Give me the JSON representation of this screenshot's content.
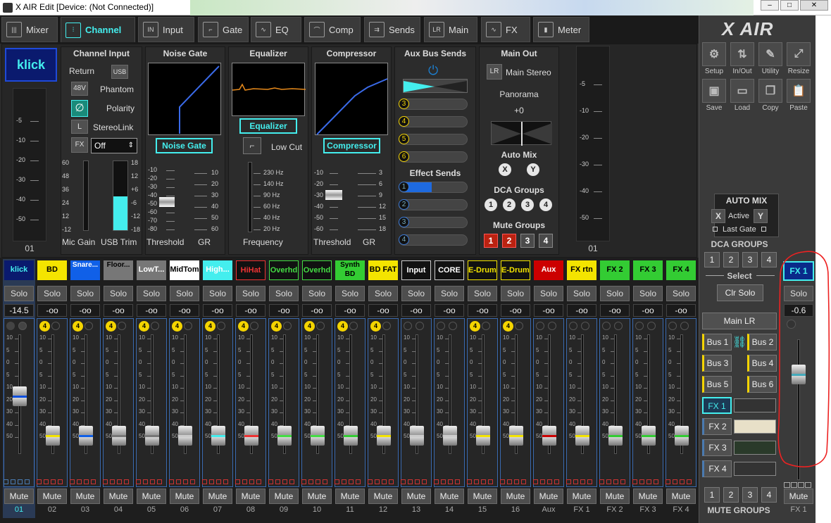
{
  "window": {
    "title": "X AIR Edit [Device: (Not Connected)]"
  },
  "tabs": [
    {
      "label": "Mixer",
      "icon": "mixer-icon",
      "glyph": "|||"
    },
    {
      "label": "Channel",
      "icon": "channel-icon",
      "glyph": "⫶"
    },
    {
      "label": "Input",
      "icon": "input-icon",
      "glyph": "IN"
    },
    {
      "label": "Gate",
      "icon": "gate-icon",
      "glyph": "⌐"
    },
    {
      "label": "EQ",
      "icon": "eq-icon",
      "glyph": "∿"
    },
    {
      "label": "Comp",
      "icon": "comp-icon",
      "glyph": "⌒"
    },
    {
      "label": "Sends",
      "icon": "sends-icon",
      "glyph": "⇉"
    },
    {
      "label": "Main",
      "icon": "main-icon",
      "glyph": "LR"
    },
    {
      "label": "FX",
      "icon": "fx-icon",
      "glyph": "∿"
    },
    {
      "label": "Meter",
      "icon": "meter-icon",
      "glyph": "▮"
    }
  ],
  "channel": {
    "name": "klick",
    "left_scale": [
      "-5",
      "-10",
      "-20",
      "-30",
      "-40",
      "-50"
    ],
    "number": "01",
    "input": {
      "title": "Channel Input",
      "return_label": "Return",
      "usb_btn": "USB",
      "phantom_btn": "48V",
      "phantom_label": "Phantom",
      "polarity_label": "Polarity",
      "polarity_glyph": "∅",
      "stereolink_btn": "L",
      "stereolink_label": "StereoLink",
      "fx_btn": "FX",
      "fx_select": "Off",
      "mic_scale": [
        "60",
        "48",
        "36",
        "24",
        "12",
        "-12"
      ],
      "trim_scale": [
        "18",
        "12",
        "+6",
        "-6",
        "-12",
        "-18"
      ],
      "mic_label": "Mic Gain",
      "trim_label": "USB Trim"
    },
    "gate": {
      "title": "Noise Gate",
      "button": "Noise Gate",
      "scale": [
        "-10",
        "-20",
        "-30",
        "-40",
        "-50",
        "-60",
        "-70",
        "-80"
      ],
      "gr_scale": [
        "10",
        "20",
        "30",
        "40",
        "50",
        "60"
      ],
      "threshold_label": "Threshold",
      "gr_label": "GR"
    },
    "eq": {
      "title": "Equalizer",
      "button": "Equalizer",
      "lowcut_label": "Low Cut",
      "freq_scale": [
        "230 Hz",
        "140 Hz",
        "90 Hz",
        "60 Hz",
        "40 Hz",
        "20 Hz"
      ],
      "freq_label": "Frequency"
    },
    "comp": {
      "title": "Compressor",
      "button": "Compressor",
      "scale": [
        "-10",
        "-20",
        "-30",
        "-40",
        "-50",
        "-60"
      ],
      "gr_scale": [
        "3",
        "6",
        "9",
        "12",
        "15",
        "18"
      ],
      "threshold_label": "Threshold",
      "gr_label": "GR"
    },
    "aux": {
      "title": "Aux Bus Sends",
      "buses": [
        "3",
        "4",
        "5",
        "6"
      ],
      "fx_title": "Effect Sends",
      "fx": [
        "1",
        "2",
        "3",
        "4"
      ]
    },
    "main": {
      "title": "Main Out",
      "lr_btn": "LR",
      "lr_label": "Main Stereo",
      "pan_label": "Panorama",
      "pan_value": "+0",
      "automix_label": "Auto Mix",
      "automix": [
        "X",
        "Y"
      ],
      "dca_label": "DCA Groups",
      "dca": [
        "1",
        "2",
        "3",
        "4"
      ],
      "mute_label": "Mute Groups",
      "mute": [
        "1",
        "2",
        "3",
        "4"
      ]
    },
    "right_scale": [
      "-5",
      "-10",
      "-20",
      "-30",
      "-40",
      "-50"
    ],
    "right_number": "01"
  },
  "strips": [
    {
      "name": "klick",
      "color": "#0a1a6e",
      "text": "#4ee",
      "val": "-14.5",
      "num": "01",
      "badge": "",
      "line": "#0b4fe0",
      "sel": true
    },
    {
      "name": "BD",
      "color": "#f4e400",
      "text": "#000",
      "val": "-oo",
      "num": "02",
      "badge": "4",
      "line": "#f4e400"
    },
    {
      "name": "Snare...",
      "color": "#1060e8",
      "text": "#fff",
      "val": "-oo",
      "num": "03",
      "badge": "4",
      "line": "#1060e8"
    },
    {
      "name": "Floor...",
      "color": "#777",
      "text": "#000",
      "val": "-oo",
      "num": "04",
      "badge": "4",
      "line": "#777"
    },
    {
      "name": "LowT...",
      "color": "#777",
      "text": "#fff",
      "val": "-oo",
      "num": "05",
      "badge": "4",
      "line": "#777"
    },
    {
      "name": "MidTom",
      "color": "#fff",
      "text": "#000",
      "val": "-oo",
      "num": "06",
      "badge": "4",
      "line": "#ccc"
    },
    {
      "name": "High...",
      "color": "#4ee",
      "text": "#fff",
      "val": "-oo",
      "num": "07",
      "badge": "4",
      "line": "#4ee"
    },
    {
      "name": "HiHat",
      "color": "#111",
      "text": "#e33",
      "border": "#e33",
      "val": "-oo",
      "num": "08",
      "badge": "4",
      "line": "#e33"
    },
    {
      "name": "Overhd",
      "color": "#111",
      "text": "#4d4",
      "border": "#4d4",
      "val": "-oo",
      "num": "09",
      "badge": "4",
      "line": "#4d4"
    },
    {
      "name": "Overhd",
      "color": "#111",
      "text": "#4d4",
      "border": "#4d4",
      "val": "-oo",
      "num": "10",
      "badge": "4",
      "line": "#4d4"
    },
    {
      "name": "Synth BD",
      "color": "#3c3",
      "text": "#000",
      "val": "-oo",
      "num": "11",
      "badge": "4",
      "line": "#3c3"
    },
    {
      "name": "BD FAT",
      "color": "#f4e400",
      "text": "#000",
      "val": "-oo",
      "num": "12",
      "badge": "4",
      "line": "#f4e400"
    },
    {
      "name": "Input",
      "color": "#111",
      "text": "#fff",
      "border": "#ccc",
      "val": "-oo",
      "num": "13",
      "badge": "",
      "line": "#ccc"
    },
    {
      "name": "CORE",
      "color": "#111",
      "text": "#fff",
      "border": "#ccc",
      "val": "-oo",
      "num": "14",
      "badge": "",
      "line": "#ccc"
    },
    {
      "name": "E-Drums",
      "color": "#111",
      "text": "#f4e400",
      "border": "#f4e400",
      "val": "-oo",
      "num": "15",
      "badge": "4",
      "line": "#f4e400"
    },
    {
      "name": "E-Drums",
      "color": "#111",
      "text": "#f4e400",
      "border": "#f4e400",
      "val": "-oo",
      "num": "16",
      "badge": "4",
      "line": "#f4e400"
    },
    {
      "name": "Aux",
      "color": "#c00",
      "text": "#fff",
      "val": "-oo",
      "num": "Aux",
      "badge": "",
      "line": "#c00"
    },
    {
      "name": "FX rtn",
      "color": "#f4e400",
      "text": "#000",
      "val": "-oo",
      "num": "FX 1",
      "badge": "",
      "line": "#f4e400"
    },
    {
      "name": "FX 2",
      "color": "#3c3",
      "text": "#000",
      "val": "-oo",
      "num": "FX 2",
      "badge": "",
      "line": "#3c3"
    },
    {
      "name": "FX 3",
      "color": "#3c3",
      "text": "#000",
      "val": "-oo",
      "num": "FX 3",
      "badge": "",
      "line": "#3c3"
    },
    {
      "name": "FX 4",
      "color": "#3c3",
      "text": "#000",
      "val": "-oo",
      "num": "FX 4",
      "badge": "",
      "line": "#3c3"
    }
  ],
  "fader_scale": [
    "10",
    "5",
    "0",
    "5",
    "10",
    "20",
    "30",
    "40",
    "50"
  ],
  "strip_solo": "Solo",
  "strip_mute": "Mute",
  "right": {
    "brand": "X AIR",
    "tools": [
      {
        "label": "Setup",
        "icon": "gear-icon",
        "glyph": "⚙"
      },
      {
        "label": "In/Out",
        "icon": "in-out-icon",
        "glyph": "⇅"
      },
      {
        "label": "Utility",
        "icon": "wrench-icon",
        "glyph": "✎"
      },
      {
        "label": "Resize",
        "icon": "resize-icon",
        "glyph": "⤢"
      },
      {
        "label": "Save",
        "icon": "save-icon",
        "glyph": "▣"
      },
      {
        "label": "Load",
        "icon": "folder-icon",
        "glyph": "▭"
      },
      {
        "label": "Copy",
        "icon": "copy-icon",
        "glyph": "❐"
      },
      {
        "label": "Paste",
        "icon": "paste-icon",
        "glyph": "📋"
      }
    ],
    "automix_title": "AUTO MIX",
    "automix_x": "X",
    "automix_active": "Active",
    "automix_y": "Y",
    "last_gate": "Last Gate",
    "dca_title": "DCA GROUPS",
    "dca": [
      "1",
      "2",
      "3",
      "4"
    ],
    "select_label": "Select",
    "clr_solo": "Clr Solo",
    "main_lr": "Main LR",
    "buses": [
      "Bus 1",
      "Bus 2",
      "Bus 3",
      "Bus 4",
      "Bus 5",
      "Bus 6"
    ],
    "fx": [
      "FX 1",
      "FX 2",
      "FX 3",
      "FX 4"
    ],
    "mute_groups": [
      "1",
      "2",
      "3",
      "4"
    ],
    "mute_title": "MUTE GROUPS"
  },
  "fx_strip": {
    "name": "FX 1",
    "solo": "Solo",
    "val": "-0.6",
    "mute": "Mute",
    "num": "FX 1"
  }
}
